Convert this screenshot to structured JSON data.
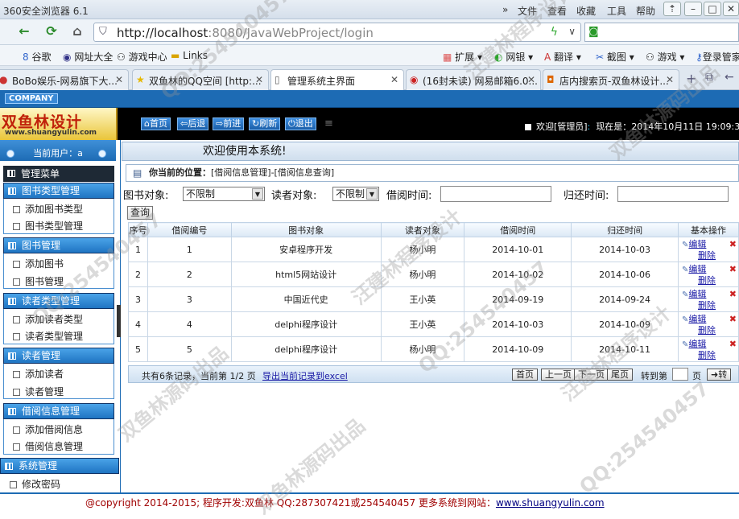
{
  "browser": {
    "title": "360安全浏览器 6.1",
    "menu": [
      "文件",
      "查看",
      "收藏",
      "工具",
      "帮助"
    ],
    "url_host": "http://localhost",
    "url_rest": ":8080/JavaWebProject/login",
    "favorites": [
      "谷歌",
      "网址大全",
      "游戏中心",
      "Links"
    ],
    "toolbar": [
      "扩展",
      "网银",
      "翻译",
      "截图",
      "游戏",
      "登录管家"
    ],
    "tabs": [
      {
        "label": "BoBo娱乐-网易旗下大..."
      },
      {
        "label": "双鱼林的QQ空间 [http:..."
      },
      {
        "label": "管理系统主界面"
      },
      {
        "label": "(16封未读) 网易邮箱6.0..."
      },
      {
        "label": "店内搜索页-双鱼林设计..."
      }
    ]
  },
  "app": {
    "company": "COMPANY",
    "logo": "双鱼林设计",
    "logo_sub": "www.shuangyulin.com",
    "nav": [
      "首页",
      "后退",
      "前进",
      "刷新",
      "退出"
    ],
    "welcome_user": "欢迎[管理员]",
    "now_label": "现在是：",
    "datetime": "2014年10月11日 19:09:38"
  },
  "sidebar": {
    "current_user_label": "当前用户：a",
    "main_menu": "管理菜单",
    "groups": [
      {
        "title": "图书类型管理",
        "items": [
          "添加图书类型",
          "图书类型管理"
        ]
      },
      {
        "title": "图书管理",
        "items": [
          "添加图书",
          "图书管理"
        ]
      },
      {
        "title": "读者类型管理",
        "items": [
          "添加读者类型",
          "读者类型管理"
        ]
      },
      {
        "title": "读者管理",
        "items": [
          "添加读者",
          "读者管理"
        ]
      },
      {
        "title": "借阅信息管理",
        "items": [
          "添加借阅信息",
          "借阅信息管理"
        ]
      },
      {
        "title": "系统管理",
        "items": [
          "修改密码"
        ]
      }
    ]
  },
  "main": {
    "welcome": "欢迎使用本系统!",
    "crumb_label": "你当前的位置：",
    "crumb_path": "[借阅信息管理]-[借阅信息查询]",
    "filters": {
      "book_label": "图书对象:",
      "book_value": "不限制",
      "reader_label": "读者对象:",
      "reader_value": "不限制",
      "borrow_label": "借阅时间:",
      "return_label": "归还时间:"
    },
    "query_button": "查询",
    "columns": [
      "序号",
      "借阅编号",
      "图书对象",
      "读者对象",
      "借阅时间",
      "归还时间",
      "基本操作"
    ],
    "rows": [
      [
        "1",
        "1",
        "安卓程序开发",
        "杨小明",
        "2014-10-01",
        "2014-10-03"
      ],
      [
        "2",
        "2",
        "html5网站设计",
        "杨小明",
        "2014-10-02",
        "2014-10-06"
      ],
      [
        "3",
        "3",
        "中国近代史",
        "王小英",
        "2014-09-19",
        "2014-09-24"
      ],
      [
        "4",
        "4",
        "delphi程序设计",
        "王小英",
        "2014-10-03",
        "2014-10-09"
      ],
      [
        "5",
        "5",
        "delphi程序设计",
        "杨小明",
        "2014-10-09",
        "2014-10-11"
      ]
    ],
    "op_edit": "编辑",
    "op_delete": "删除",
    "pager": {
      "info": "共有6条记录，当前第 1/2 页",
      "export": "导出当前记录到excel",
      "first": "首页",
      "prev": "上一页",
      "next": "下一页",
      "last": "尾页",
      "goto_label": "转到第",
      "page_unit": "页",
      "go": "转"
    }
  },
  "footer": {
    "text": "@copyright 2014-2015; 程序开发:双鱼林  QQ:287307421或254540457  更多系统到网站：",
    "url": "www.shuangyulin.com"
  },
  "watermarks": [
    "QQ:254540457",
    "汪建林程序设计",
    "双鱼林源码出品",
    "QQ:254540457",
    "汪建林程序设计",
    "双鱼林源码出品",
    "QQ:254540457",
    "汪建林程序设计",
    "双鱼林源码出品",
    "QQ:254540457"
  ]
}
